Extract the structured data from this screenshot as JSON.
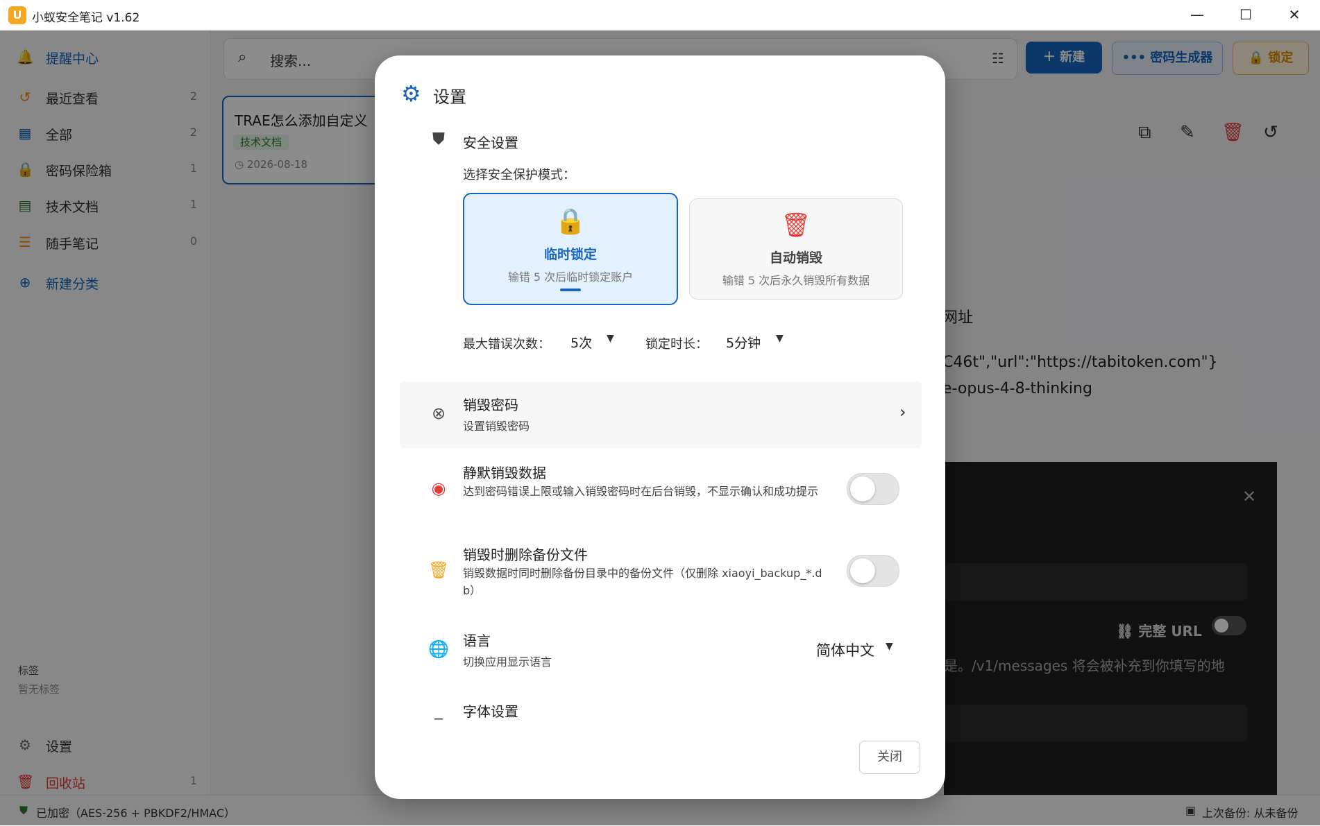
{
  "app": {
    "title": "小蚁安全笔记 v1.62",
    "logo_letter": "U"
  },
  "window": {
    "minimize": "—",
    "maximize": "☐",
    "close": "✕"
  },
  "sidebar": {
    "reminder": "提醒中心",
    "items": [
      {
        "label": "最近查看",
        "count": "2",
        "icon": "history-icon"
      },
      {
        "label": "全部",
        "count": "2",
        "icon": "grid-icon"
      },
      {
        "label": "密码保险箱",
        "count": "1",
        "icon": "lock-icon"
      },
      {
        "label": "技术文档",
        "count": "1",
        "icon": "document-icon"
      },
      {
        "label": "随手笔记",
        "count": "0",
        "icon": "notebook-icon"
      }
    ],
    "new_category": "新建分类",
    "tags_title": "标签",
    "tags_empty": "暂无标签",
    "settings": "设置",
    "trash": "回收站",
    "trash_count": "1"
  },
  "toolbar": {
    "search_placeholder": "搜索...",
    "new_label": "新建",
    "generator_label": "密码生成器",
    "lock_label": "锁定"
  },
  "note_card": {
    "title": "TRAE怎么添加自定义",
    "tag": "技术文档",
    "date": "2026-08-18"
  },
  "background_content": {
    "line1": "网址",
    "line2": "C46t\",\"url\":\"https://tabitoken.com\"}",
    "line3": "e-opus-4-8-thinking",
    "dark_url_label": "完整 URL",
    "dark_hint": "是。/v1/messages 将会被补充到你填写的地"
  },
  "status": {
    "encrypted": "已加密（AES-256 + PBKDF2/HMAC）",
    "backup": "上次备份: 从未备份"
  },
  "modal": {
    "title": "设置",
    "security_title": "安全设置",
    "mode_prompt": "选择安全保护模式：",
    "modes": [
      {
        "title": "临时锁定",
        "desc": "输错 5 次后临时锁定账户",
        "selected": true
      },
      {
        "title": "自动销毁",
        "desc": "输错 5 次后永久销毁所有数据",
        "selected": false
      }
    ],
    "max_errors_label": "最大错误次数：",
    "max_errors_value": "5次",
    "lock_duration_label": "锁定时长：",
    "lock_duration_value": "5分钟",
    "destroy_password": {
      "title": "销毁密码",
      "desc": "设置销毁密码"
    },
    "silent_destroy": {
      "title": "静默销毁数据",
      "desc": "达到密码错误上限或输入销毁密码时在后台销毁，不显示确认和成功提示",
      "enabled": false
    },
    "delete_backup": {
      "title": "销毁时删除备份文件",
      "desc": "销毁数据时同时删除备份目录中的备份文件（仅删除 xiaoyi_backup_*.db）",
      "enabled": false
    },
    "language": {
      "title": "语言",
      "desc": "切换应用显示语言",
      "value": "简体中文"
    },
    "font_settings": "字体设置",
    "close_label": "关闭"
  },
  "colors": {
    "primary": "#1565c0",
    "accent_orange": "#f5a623",
    "danger": "#e53935",
    "selected_card_bg": "#e3f0fd"
  }
}
